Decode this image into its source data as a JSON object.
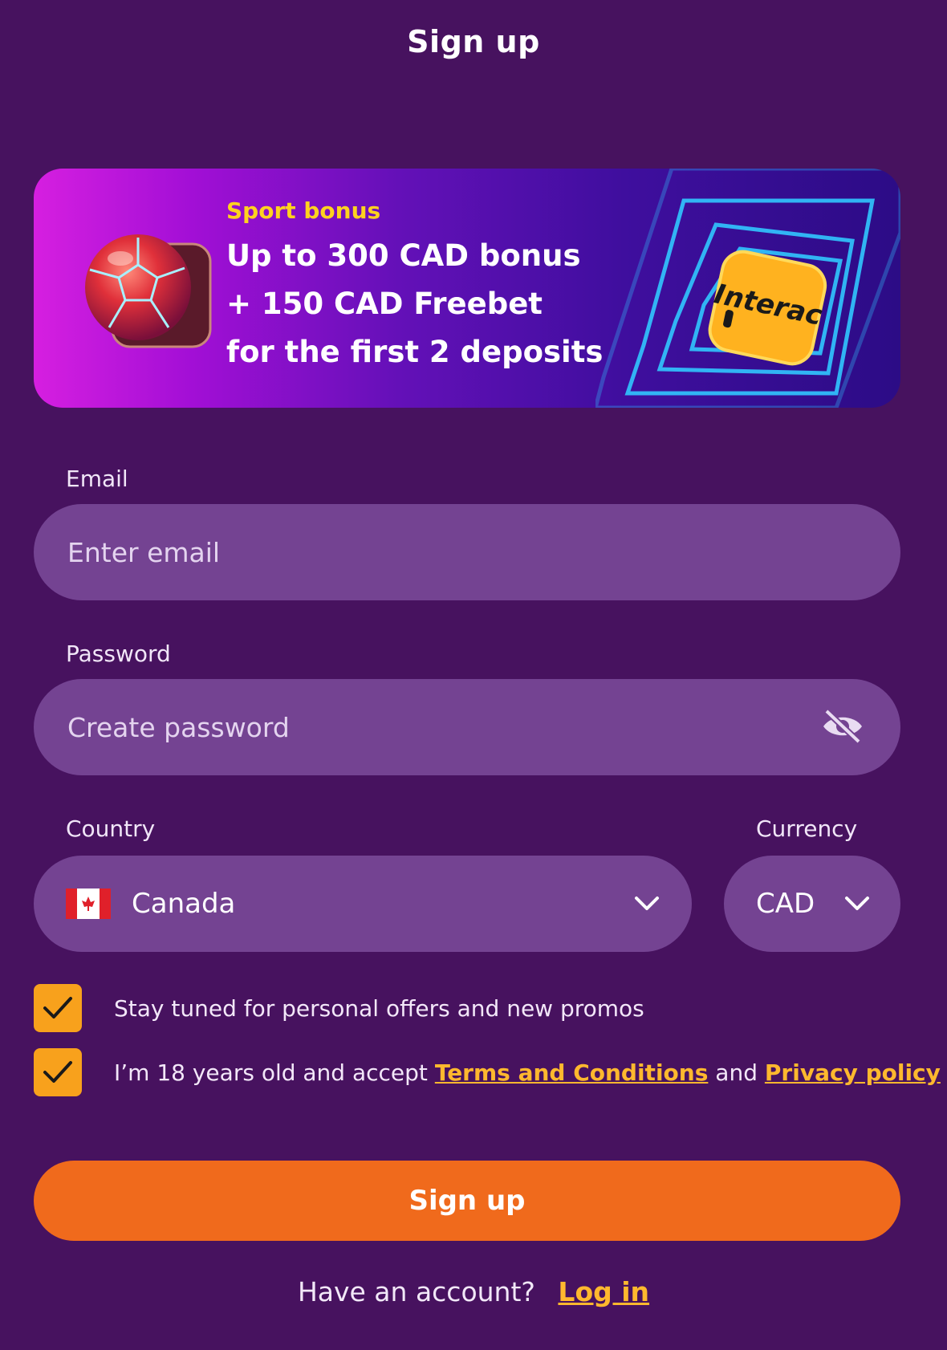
{
  "header": {
    "title": "Sign up"
  },
  "banner": {
    "kicker": "Sport bonus",
    "lines": [
      "Up to 300 CAD bonus",
      "+ 150 CAD Freebet",
      "for the first 2 deposits"
    ],
    "payment_logo_text": "Interac"
  },
  "form": {
    "email": {
      "label": "Email",
      "placeholder": "Enter email"
    },
    "password": {
      "label": "Password",
      "placeholder": "Create password"
    },
    "country": {
      "label": "Country",
      "value": "Canada"
    },
    "currency": {
      "label": "Currency",
      "value": "CAD"
    },
    "checkboxes": {
      "promos": {
        "checked": true,
        "text": "Stay tuned for personal offers and new promos"
      },
      "terms": {
        "checked": true,
        "prefix": "I’m 18 years old and accept",
        "terms_link": "Terms and Conditions",
        "and_text": "and",
        "privacy_link": "Privacy policy"
      }
    },
    "submit_label": "Sign up"
  },
  "footer": {
    "prompt": "Have an account?",
    "login_link": "Log in"
  },
  "colors": {
    "background": "#47125f",
    "field": "#744392",
    "accent_orange": "#f06a1c",
    "checkbox": "#f8a11c",
    "link_yellow": "#ffb82e",
    "kicker_yellow": "#ffd21f"
  },
  "icons": [
    "soccer-ball-icon",
    "interac-logo",
    "eye-off-icon",
    "canada-flag-icon",
    "chevron-down-icon",
    "checkmark-icon"
  ]
}
